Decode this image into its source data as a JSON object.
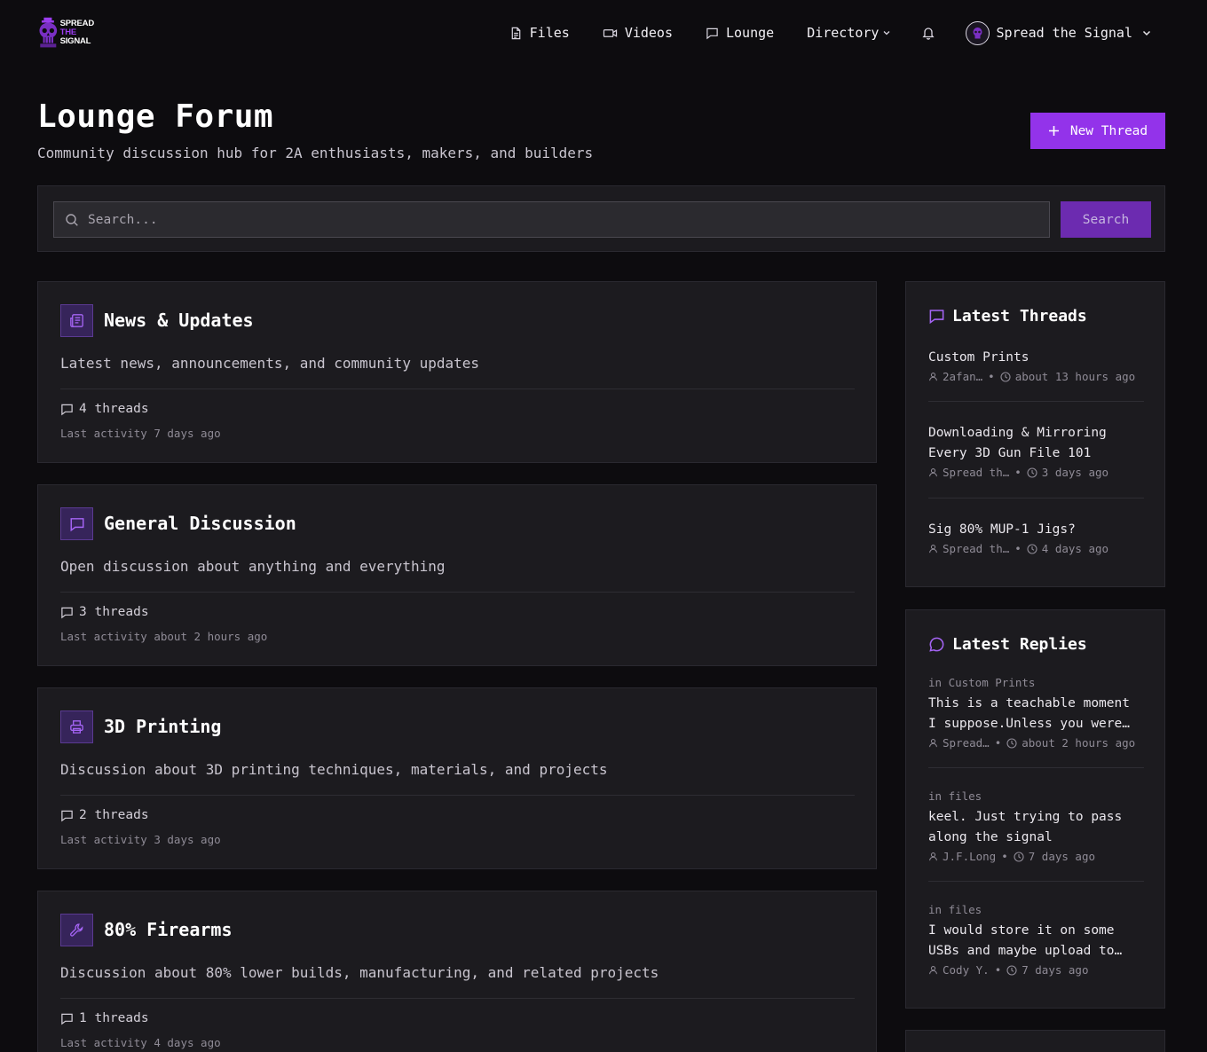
{
  "brand": {
    "logo_line1": "SPREAD",
    "logo_line2": "THE",
    "logo_line3": "SIGNAL",
    "accent_color": "#9333ea"
  },
  "nav": {
    "items": [
      {
        "label": "Files",
        "icon": "file-icon"
      },
      {
        "label": "Videos",
        "icon": "video-icon"
      },
      {
        "label": "Lounge",
        "icon": "chat-icon"
      },
      {
        "label": "Directory",
        "icon": "chevron-down-icon"
      }
    ],
    "user_name": "Spread the Signal"
  },
  "page": {
    "title": "Lounge Forum",
    "subtitle": "Community discussion hub for 2A enthusiasts, makers, and builders",
    "new_thread_label": "New Thread"
  },
  "search": {
    "placeholder": "Search...",
    "button_label": "Search"
  },
  "categories": [
    {
      "title": "News & Updates",
      "description": "Latest news, announcements, and community updates",
      "threads": "4 threads",
      "activity": "Last activity 7 days ago",
      "icon": "newspaper-icon"
    },
    {
      "title": "General Discussion",
      "description": "Open discussion about anything and everything",
      "threads": "3 threads",
      "activity": "Last activity about 2 hours ago",
      "icon": "chat-icon"
    },
    {
      "title": "3D Printing",
      "description": "Discussion about 3D printing techniques, materials, and projects",
      "threads": "2 threads",
      "activity": "Last activity 3 days ago",
      "icon": "printer-icon"
    },
    {
      "title": "80% Firearms",
      "description": "Discussion about 80% lower builds, manufacturing, and related projects",
      "threads": "1 threads",
      "activity": "Last activity 4 days ago",
      "icon": "wrench-icon"
    }
  ],
  "latest_threads": {
    "heading": "Latest Threads",
    "items": [
      {
        "title": "Custom Prints",
        "author": "2afan…",
        "time": "about 13 hours ago"
      },
      {
        "title": "Downloading & Mirroring Every 3D Gun File 101",
        "author": "Spread th…",
        "time": "3 days ago"
      },
      {
        "title": "Sig 80% MUP-1 Jigs?",
        "author": "Spread th…",
        "time": "4 days ago"
      }
    ]
  },
  "latest_replies": {
    "heading": "Latest Replies",
    "items": [
      {
        "context": "in Custom Prints",
        "text": "This is a teachable moment I suppose.Unless you were…",
        "author": "Spread…",
        "time": "about 2 hours ago"
      },
      {
        "context": "in files",
        "text": "keel. Just trying to pass along the signal",
        "author": "J.F.Long",
        "time": "7 days ago"
      },
      {
        "context": "in files",
        "text": "I would store it on some USBs and maybe upload to…",
        "author": "Cody Y.",
        "time": "7 days ago"
      }
    ]
  }
}
